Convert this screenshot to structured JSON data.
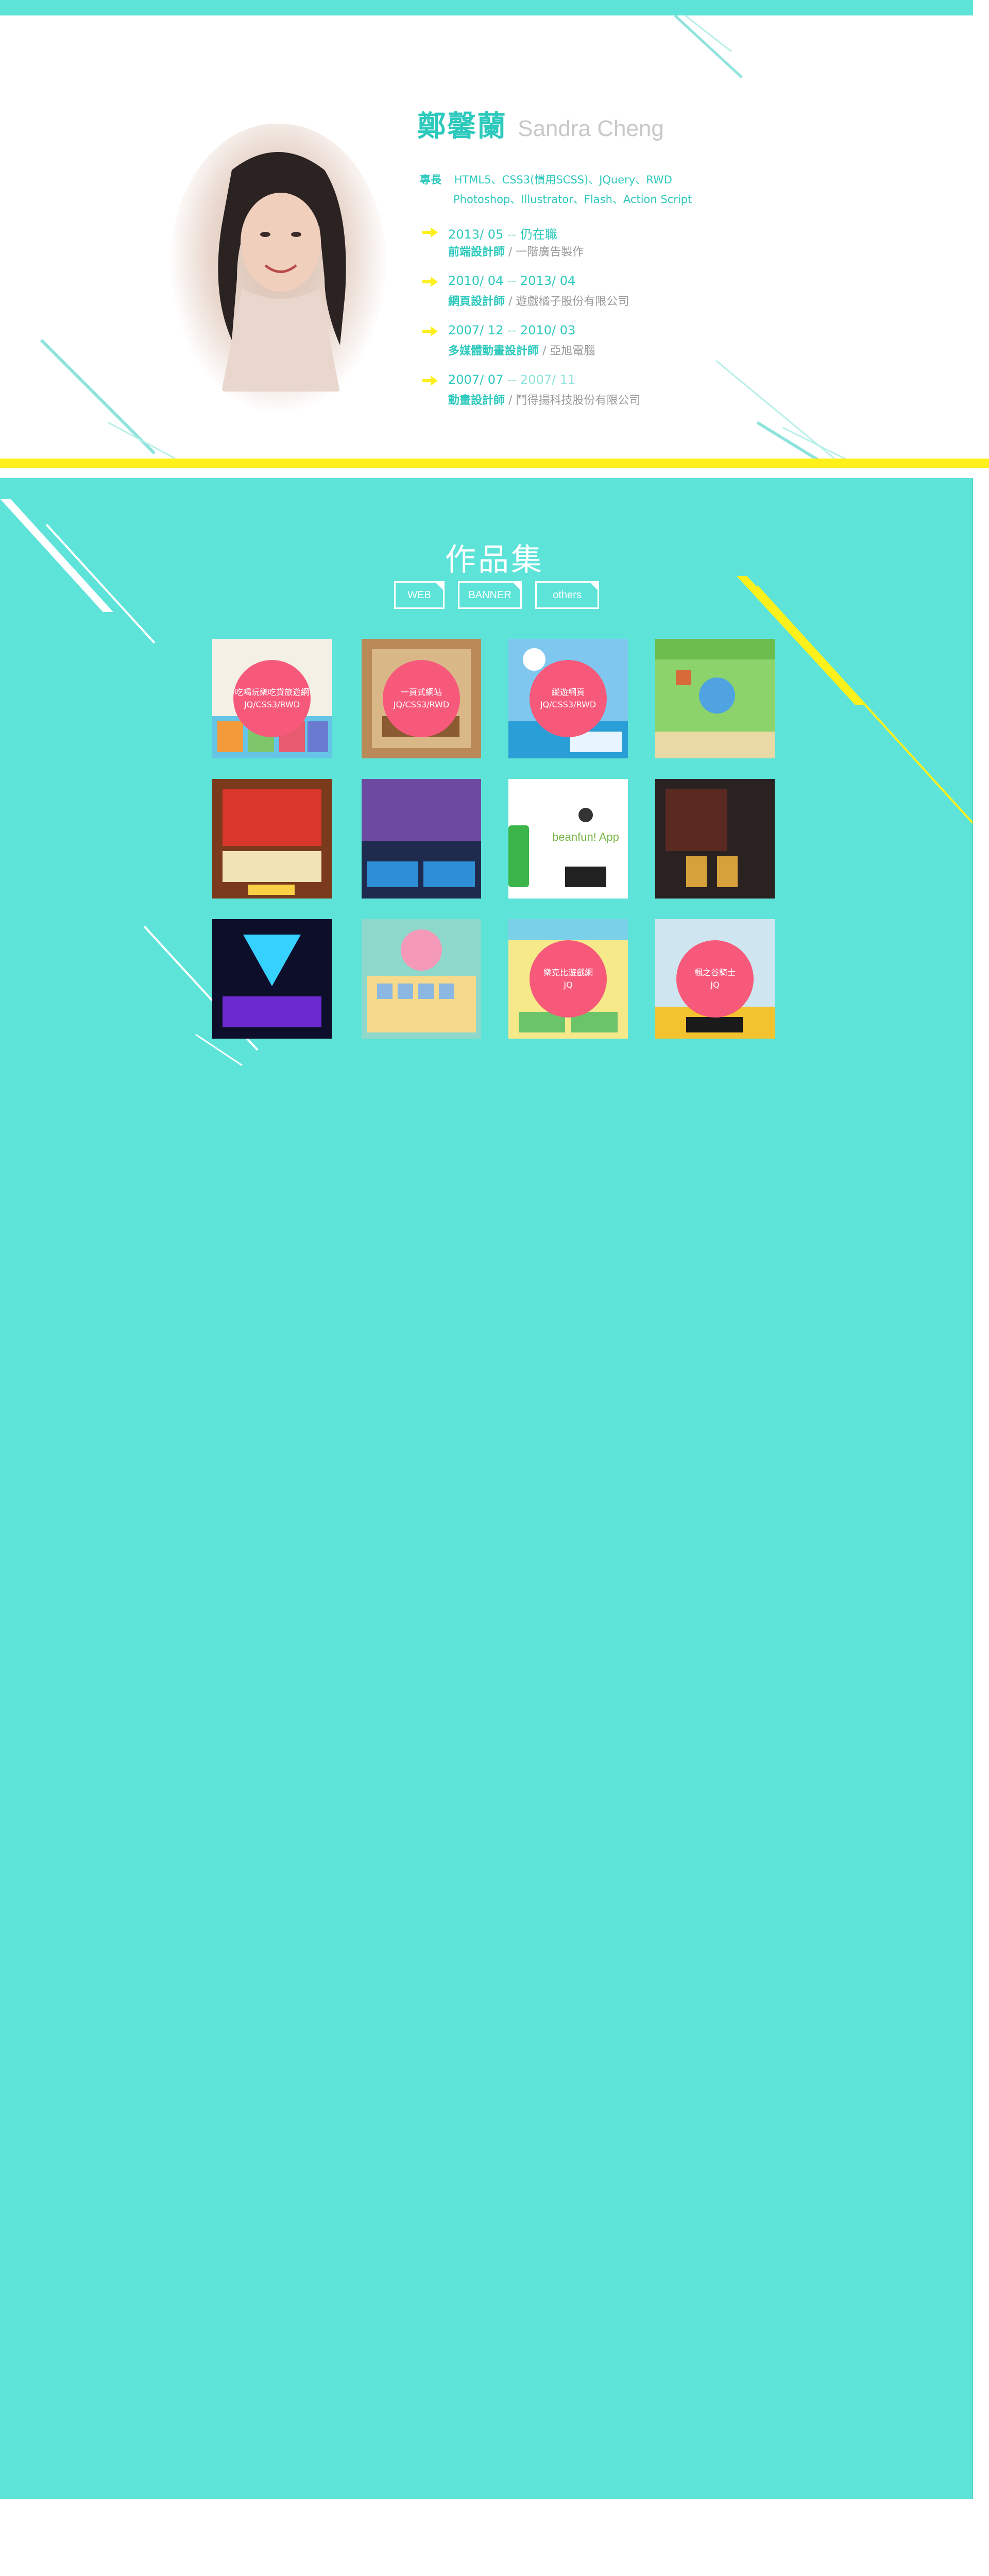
{
  "profile": {
    "name_zh": "鄭馨蘭",
    "name_en": "Sandra Cheng",
    "skills_label": "專長",
    "skills_line1": "HTML5、CSS3(慣用SCSS)、JQuery、RWD",
    "skills_line2": "Photoshop、Illustrator、Flash、Action Script"
  },
  "timeline": [
    {
      "start": "2013/ 05",
      "sep": " -- ",
      "end": "仍在職",
      "title": "前端設計師",
      "company": " / 一階廣告製作"
    },
    {
      "start": "2010/ 04",
      "sep": " -- ",
      "end": "2013/ 04",
      "title": "網頁設計師",
      "company": " / 遊戲橘子股份有限公司"
    },
    {
      "start": "2007/ 12",
      "sep": " -- ",
      "end": "2010/ 03",
      "title": "多媒體動畫設計師",
      "company": " / 亞旭電腦"
    },
    {
      "start": "2007/ 07",
      "sep": " -- ",
      "end": "2007/ 11",
      "title": "動畫設計師",
      "company": " / 鬥得揚科技股份有限公司"
    }
  ],
  "portfolio": {
    "title": "作品集",
    "filters": [
      "WEB",
      "BANNER",
      "others"
    ],
    "tiles": [
      {
        "line1": "吃喝玩樂吃貨旅遊網",
        "line2": "JQ/CSS3/RWD"
      },
      {
        "line1": "一頁式網站",
        "line2": "JQ/CSS3/RWD"
      },
      {
        "line1": "縱遊網頁",
        "line2": "JQ/CSS3/RWD"
      },
      {
        "line1": "",
        "line2": ""
      },
      {
        "line1": "",
        "line2": ""
      },
      {
        "line1": "",
        "line2": ""
      },
      {
        "line1": "",
        "line2": ""
      },
      {
        "line1": "",
        "line2": ""
      },
      {
        "line1": "",
        "line2": ""
      },
      {
        "line1": "",
        "line2": ""
      },
      {
        "line1": "樂克比遊戲網",
        "line2": "JQ"
      },
      {
        "line1": "楓之谷騎士",
        "line2": "JQ"
      }
    ],
    "tile_texts": {
      "t3_caption": "beanfun! App"
    }
  },
  "colors": {
    "accent": "#5ee3d9",
    "accent_text": "#2ec9bd",
    "yellow": "#fdf01b",
    "bubble": "#f7597b"
  }
}
